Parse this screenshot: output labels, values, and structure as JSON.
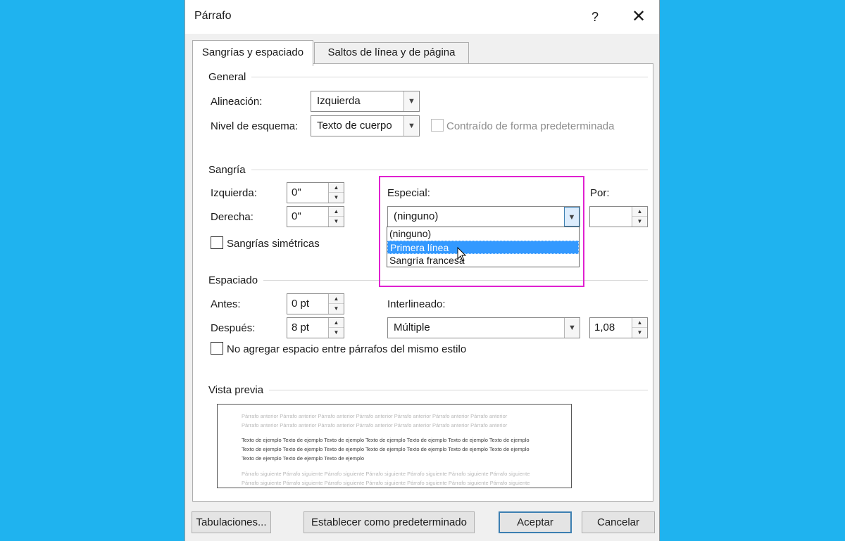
{
  "dialog": {
    "title": "Párrafo",
    "help": "?",
    "close": "✕"
  },
  "tabs": [
    {
      "label": "Sangrías y espaciado",
      "active": true
    },
    {
      "label": "Saltos de línea y de página",
      "active": false
    }
  ],
  "general": {
    "section": "General",
    "alineacion_label": "Alineación:",
    "alineacion_value": "Izquierda",
    "nivel_label": "Nivel de esquema:",
    "nivel_value": "Texto de cuerpo",
    "contraido_label": "Contraído de forma predeterminada"
  },
  "sangria": {
    "section": "Sangría",
    "izquierda_label": "Izquierda:",
    "izquierda_value": "0\"",
    "derecha_label": "Derecha:",
    "derecha_value": "0\"",
    "especial_label": "Especial:",
    "especial_value": "(ninguno)",
    "especial_options": [
      "(ninguno)",
      "Primera línea",
      "Sangría francesa"
    ],
    "especial_highlighted": "Primera línea",
    "por_label": "Por:",
    "por_value": "",
    "simetricas_label": "Sangrías simétricas"
  },
  "espaciado": {
    "section": "Espaciado",
    "antes_label": "Antes:",
    "antes_value": "0 pt",
    "despues_label": "Después:",
    "despues_value": "8 pt",
    "interlineado_label": "Interlineado:",
    "interlineado_value": "Múltiple",
    "en_value": "1,08",
    "no_agregar_label": "No agregar espacio entre párrafos del mismo estilo"
  },
  "preview": {
    "section": "Vista previa",
    "lines": [
      "Párrafo anterior Párrafo anterior Párrafo anterior Párrafo anterior Párrafo anterior Párrafo anterior Párrafo anterior",
      "Párrafo anterior Párrafo anterior Párrafo anterior Párrafo anterior Párrafo anterior Párrafo anterior Párrafo anterior",
      "Texto de ejemplo Texto de ejemplo Texto de ejemplo Texto de ejemplo Texto de ejemplo Texto de ejemplo Texto de ejemplo",
      "Texto de ejemplo Texto de ejemplo Texto de ejemplo Texto de ejemplo Texto de ejemplo Texto de ejemplo Texto de ejemplo",
      "Texto de ejemplo Texto de ejemplo Texto de ejemplo",
      "Párrafo siguiente Párrafo siguiente Párrafo siguiente Párrafo siguiente Párrafo siguiente Párrafo siguiente Párrafo siguiente",
      "Párrafo siguiente Párrafo siguiente Párrafo siguiente Párrafo siguiente Párrafo siguiente Párrafo siguiente Párrafo siguiente"
    ]
  },
  "buttons": {
    "tabulaciones": "Tabulaciones...",
    "establecer": "Establecer como predeterminado",
    "aceptar": "Aceptar",
    "cancelar": "Cancelar"
  },
  "colors": {
    "background": "#1fb3ef",
    "highlight_border": "#e020d0",
    "selection": "#3399ff"
  }
}
